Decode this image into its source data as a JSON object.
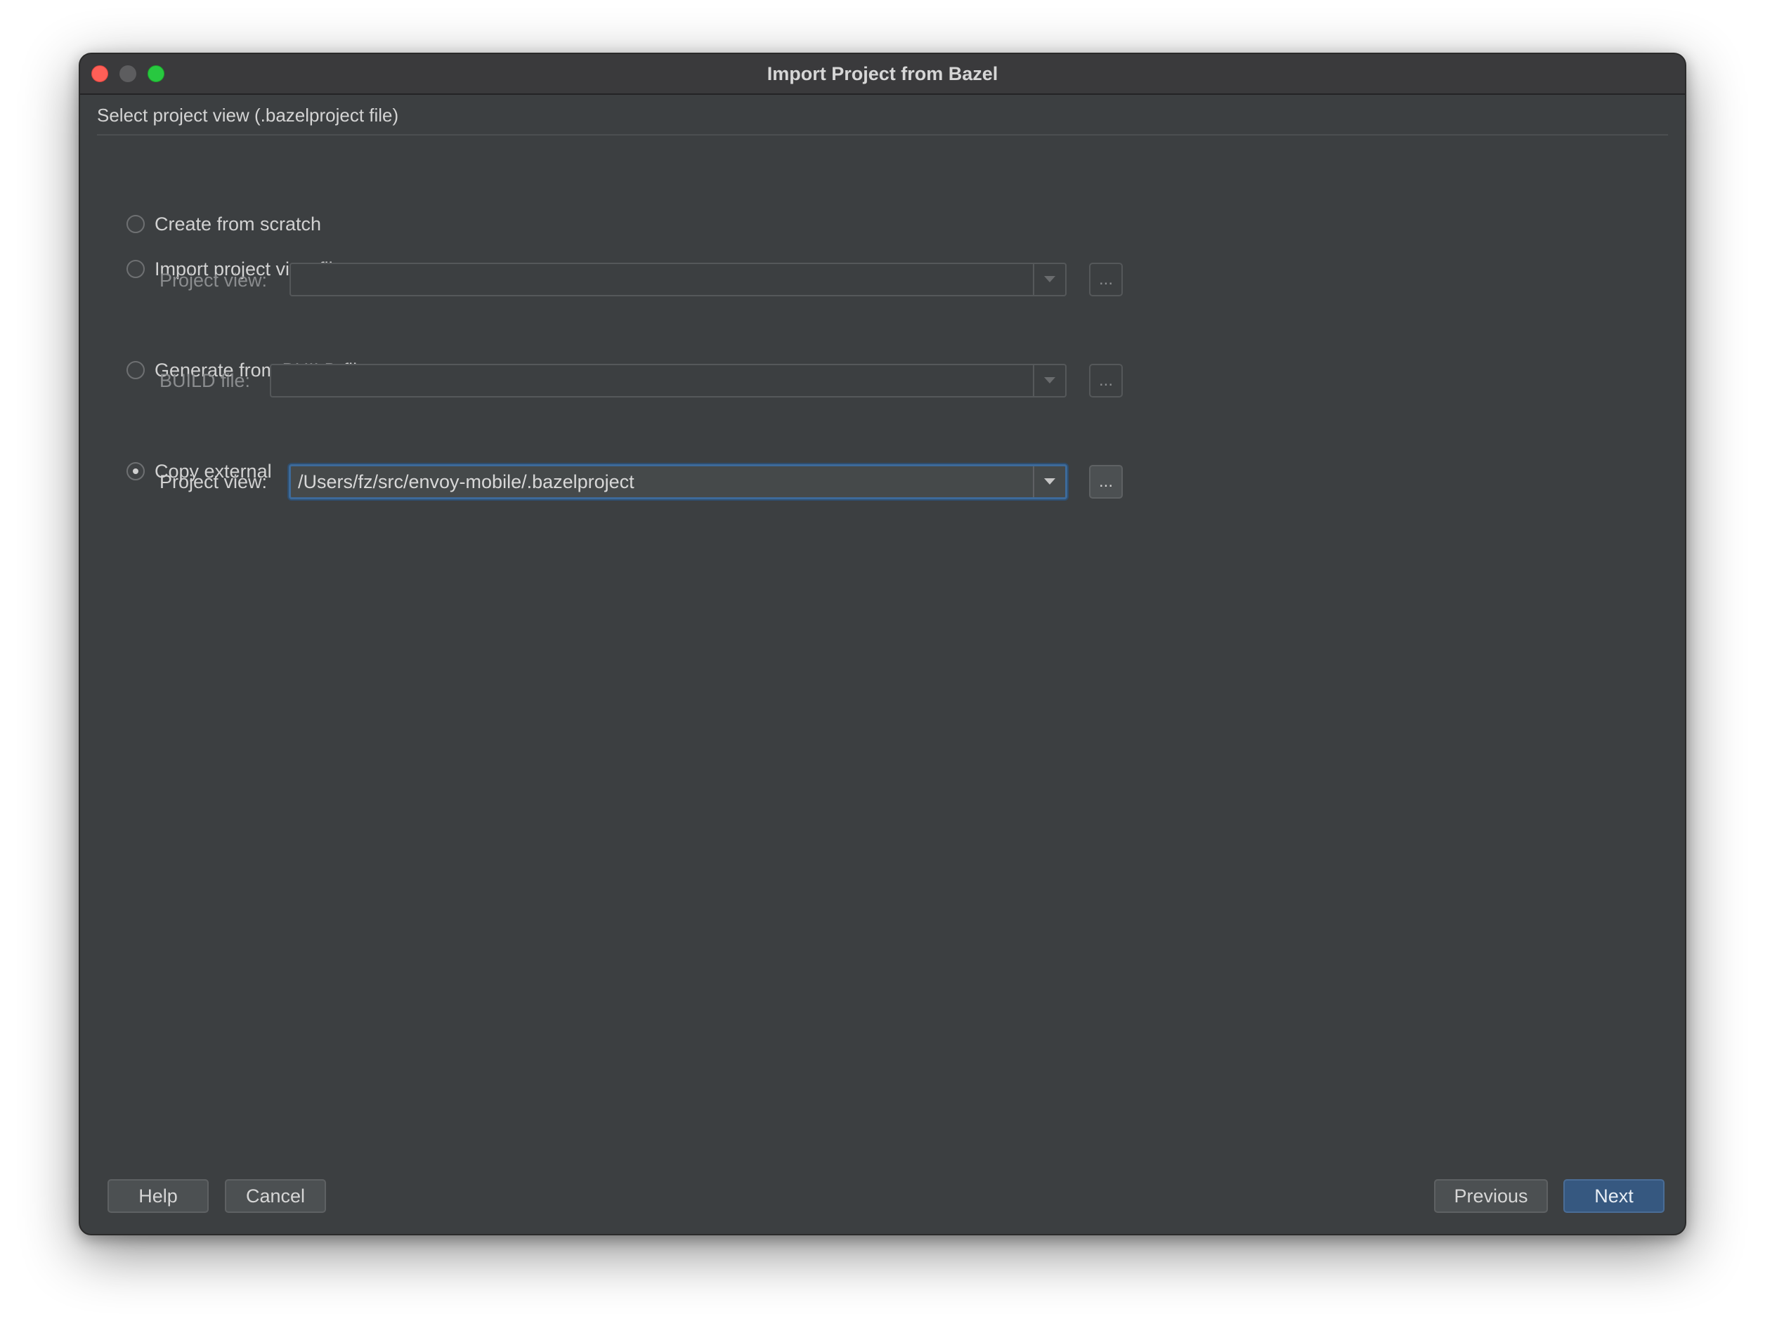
{
  "window": {
    "title": "Import Project from Bazel"
  },
  "section": {
    "header": "Select project view (.bazelproject file)"
  },
  "options": {
    "create_from_scratch": "Create from scratch",
    "import_project_view_file": "Import project view file",
    "generate_from_build_file": "Generate from BUILD file",
    "copy_external": "Copy external",
    "selected": "copy_external"
  },
  "import_field": {
    "label": "Project view:",
    "value": ""
  },
  "build_field": {
    "label": "BUILD file:",
    "value": ""
  },
  "copy_field": {
    "label": "Project view:",
    "value": "/Users/fz/src/envoy-mobile/.bazelproject"
  },
  "browse_label": "...",
  "footer": {
    "help": "Help",
    "cancel": "Cancel",
    "previous": "Previous",
    "next": "Next"
  },
  "colors": {
    "background": "#3c3f41",
    "focus_border": "#3d6a9a",
    "primary_button": "#365880"
  }
}
